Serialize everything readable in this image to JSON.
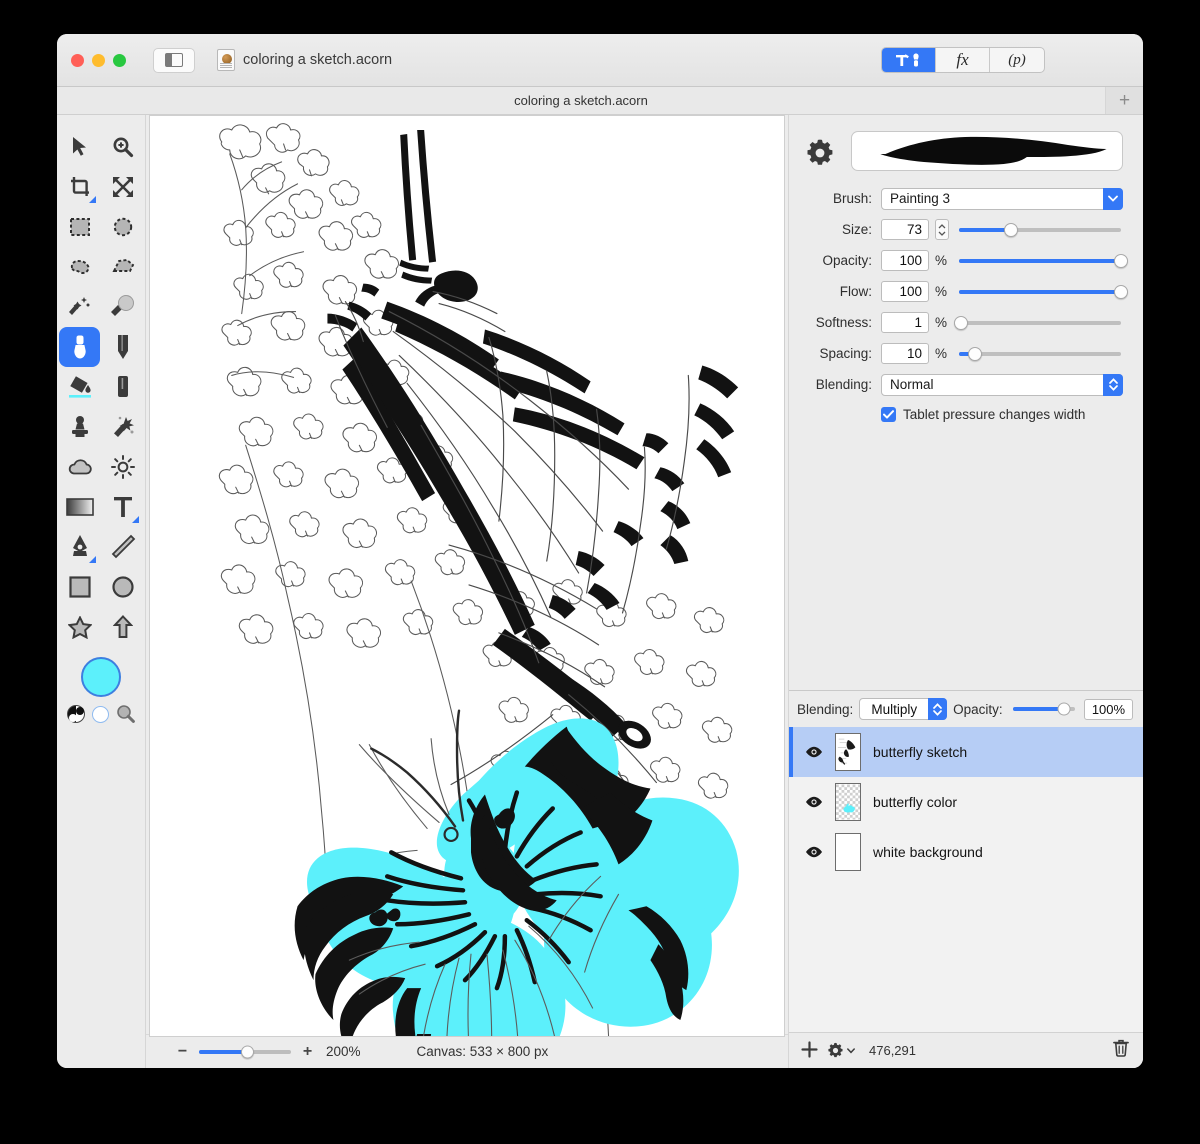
{
  "window": {
    "document_title": "coloring a sketch.acorn",
    "tab_title": "coloring a sketch.acorn",
    "traffic_lights": [
      "close-button",
      "minimize-button",
      "zoom-button"
    ],
    "sidebar_toggle_icon": "sidebar-toggle-icon",
    "document_icon": "acorn-document-icon",
    "add_tab_label": "+"
  },
  "inspector_tabs": [
    {
      "id": "tools",
      "icon": "hammer-brush-icon",
      "label": "",
      "active": true
    },
    {
      "id": "filters",
      "icon": "fx-icon",
      "label": "fx",
      "active": false
    },
    {
      "id": "presets",
      "icon": "p-icon",
      "label": "(p)",
      "active": false
    }
  ],
  "tools": {
    "items": [
      {
        "name": "move-tool",
        "icon": "cursor-arrow-icon",
        "selected": false,
        "corner": false
      },
      {
        "name": "zoom-tool",
        "icon": "magnifier-plus-icon",
        "selected": false,
        "corner": false
      },
      {
        "name": "crop-tool",
        "icon": "crop-icon",
        "selected": false,
        "corner": true
      },
      {
        "name": "transform-tool",
        "icon": "four-arrows-icon",
        "selected": false,
        "corner": false
      },
      {
        "name": "rectangular-selection-tool",
        "icon": "dashed-rectangle-icon",
        "selected": false,
        "corner": false
      },
      {
        "name": "elliptical-selection-tool",
        "icon": "dashed-ellipse-icon",
        "selected": false,
        "corner": false
      },
      {
        "name": "lasso-tool",
        "icon": "lasso-icon",
        "selected": false,
        "corner": false
      },
      {
        "name": "polygon-lasso-tool",
        "icon": "polygon-lasso-icon",
        "selected": false,
        "corner": false
      },
      {
        "name": "magic-wand-tool",
        "icon": "magic-wand-icon",
        "selected": false,
        "corner": false
      },
      {
        "name": "instant-alpha-tool",
        "icon": "instant-alpha-icon",
        "selected": false,
        "corner": false
      },
      {
        "name": "brush-tool",
        "icon": "paintbrush-icon",
        "selected": true,
        "corner": false
      },
      {
        "name": "pencil-tool",
        "icon": "pencil-icon",
        "selected": false,
        "corner": false
      },
      {
        "name": "paint-bucket-tool",
        "icon": "paint-bucket-icon",
        "selected": false,
        "corner": false
      },
      {
        "name": "eraser-tool",
        "icon": "eraser-icon",
        "selected": false,
        "corner": false
      },
      {
        "name": "clone-stamp-tool",
        "icon": "clone-stamp-icon",
        "selected": false,
        "corner": false
      },
      {
        "name": "smudge-tool",
        "icon": "smudge-splatter-icon",
        "selected": false,
        "corner": false
      },
      {
        "name": "blur-tool",
        "icon": "cloud-blur-icon",
        "selected": false,
        "corner": false
      },
      {
        "name": "dodge-tool",
        "icon": "sun-dodge-icon",
        "selected": false,
        "corner": false
      },
      {
        "name": "gradient-tool",
        "icon": "gradient-icon",
        "selected": false,
        "corner": false
      },
      {
        "name": "text-tool",
        "icon": "text-t-icon",
        "selected": false,
        "corner": true
      },
      {
        "name": "bezier-pen-tool",
        "icon": "pen-nib-icon",
        "selected": false,
        "corner": true
      },
      {
        "name": "line-tool",
        "icon": "line-icon",
        "selected": false,
        "corner": false
      },
      {
        "name": "rectangle-shape-tool",
        "icon": "rectangle-icon",
        "selected": false,
        "corner": false
      },
      {
        "name": "ellipse-shape-tool",
        "icon": "ellipse-icon",
        "selected": false,
        "corner": false
      },
      {
        "name": "star-shape-tool",
        "icon": "star-icon",
        "selected": false,
        "corner": false
      },
      {
        "name": "arrow-shape-tool",
        "icon": "arrow-up-icon",
        "selected": false,
        "corner": false
      }
    ],
    "foreground_color": "#5cf0fb",
    "background_color": "#ffffff",
    "swap_icon": "yin-yang-invert-icon",
    "picker_icon": "magnifier-picker-icon"
  },
  "brush_inspector": {
    "gear_icon": "gear-icon",
    "preview_icon": "brush-stroke-preview",
    "brush_label": "Brush:",
    "brush_value": "Painting 3",
    "size_label": "Size:",
    "size_value": "73",
    "size_slider_pct": 32,
    "opacity_label": "Opacity:",
    "opacity_value": "100",
    "opacity_unit": "%",
    "opacity_slider_pct": 100,
    "flow_label": "Flow:",
    "flow_value": "100",
    "flow_unit": "%",
    "flow_slider_pct": 100,
    "softness_label": "Softness:",
    "softness_value": "1",
    "softness_unit": "%",
    "softness_slider_pct": 1,
    "spacing_label": "Spacing:",
    "spacing_value": "10",
    "spacing_unit": "%",
    "spacing_slider_pct": 10,
    "blending_label": "Blending:",
    "blending_value": "Normal",
    "tablet_checkbox_label": "Tablet pressure changes width",
    "tablet_checkbox_checked": true,
    "accent_color": "#3478f6"
  },
  "layers_panel": {
    "blending_label": "Blending:",
    "blending_value": "Multiply",
    "opacity_label": "Opacity:",
    "opacity_value": "100%",
    "opacity_slider_pct": 82,
    "layers": [
      {
        "name": "butterfly sketch",
        "visible": true,
        "selected": true,
        "thumb": "sketch-thumbnail"
      },
      {
        "name": "butterfly color",
        "visible": true,
        "selected": false,
        "thumb": "transparent-cyan-thumbnail"
      },
      {
        "name": "white background",
        "visible": true,
        "selected": false,
        "thumb": "white-thumbnail"
      }
    ],
    "footer": {
      "add_icon": "plus-icon",
      "settings_icon": "gear-dropdown-icon",
      "coordinates": "476,291",
      "delete_icon": "trash-icon"
    }
  },
  "status_bar": {
    "zoom_out_label": "−",
    "zoom_in_label": "+",
    "zoom_value": "200%",
    "zoom_slider_pct": 46,
    "canvas_label": "Canvas: 533 × 800 px"
  },
  "canvas": {
    "artwork_name": "butterfly-sketch-with-cyan-coloring",
    "paint_color": "#5cf0fb",
    "ink_color": "#111111"
  }
}
